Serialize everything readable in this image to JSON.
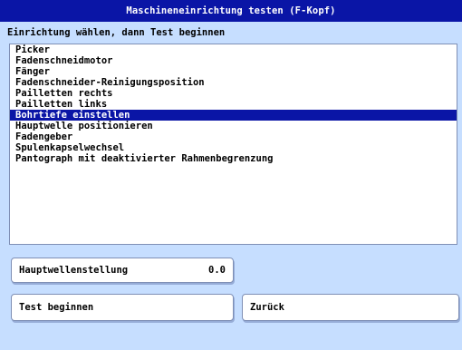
{
  "window": {
    "title": "Maschineneinrichtung testen (F-Kopf)"
  },
  "instruction": "Einrichtung wählen, dann Test beginnen",
  "list": {
    "items": [
      "Picker",
      "Fadenschneidmotor",
      "Fänger",
      "Fadenschneider-Reinigungsposition",
      "Pailletten rechts",
      "Pailletten links",
      "Bohrtiefe einstellen",
      "Hauptwelle positionieren",
      "Fadengeber",
      "Spulenkapselwechsel",
      "Pantograph mit deaktivierter Rahmenbegrenzung"
    ],
    "selected_index": 6
  },
  "main_shaft_position": {
    "label": "Hauptwellenstellung",
    "value": "0.0"
  },
  "buttons": {
    "start_test": "Test beginnen",
    "back": "Zurück"
  },
  "colors": {
    "title_bar": "#0a15a6",
    "selection": "#0a15a6",
    "background": "#c6deff",
    "panel": "#ffffff"
  }
}
